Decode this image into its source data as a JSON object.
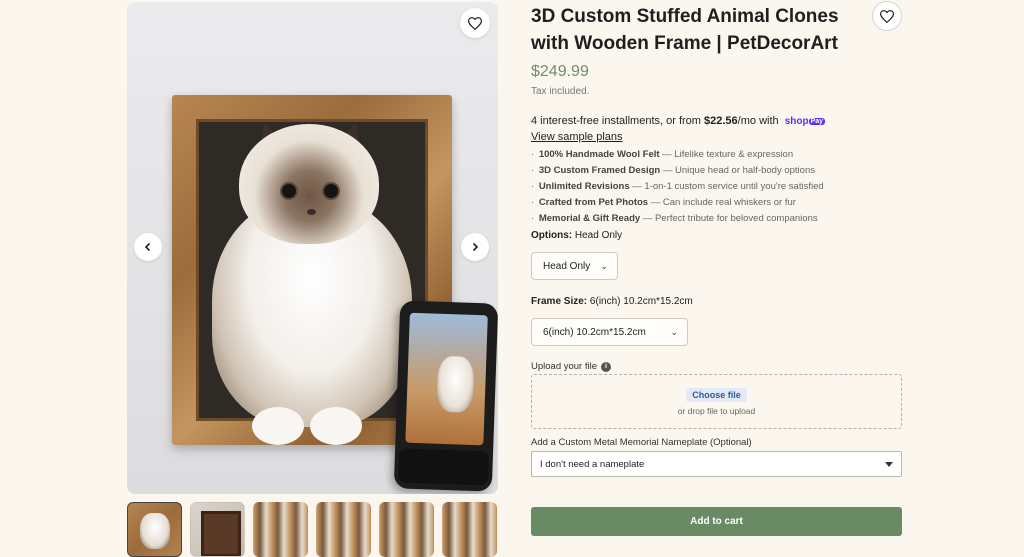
{
  "product": {
    "title": "3D Custom Stuffed Animal Clones with Wooden Frame | PetDecorArt",
    "price": "$249.99",
    "tax_note": "Tax included."
  },
  "installments": {
    "prefix": "4 interest-free installments, or from",
    "amount": "$22.56",
    "suffix": "/mo with",
    "brand": "shop",
    "brand_tag": "Pay",
    "brand_color": "#5a31f4",
    "sample_link": "View sample plans"
  },
  "features": [
    {
      "title": "100% Handmade Wool Felt",
      "desc": "— Lifelike texture & expression"
    },
    {
      "title": "3D Custom Framed Design",
      "desc": "— Unique head or half-body options"
    },
    {
      "title": "Unlimited Revisions",
      "desc": "— 1-on-1 custom service until you're satisfied"
    },
    {
      "title": "Crafted from Pet Photos",
      "desc": "— Can include real whiskers or fur"
    },
    {
      "title": "Memorial & Gift Ready",
      "desc": "— Perfect tribute for beloved companions"
    }
  ],
  "options": {
    "label": "Options:",
    "value": "Head Only",
    "selected": "Head Only"
  },
  "frame_size": {
    "label": "Frame Size:",
    "value": "6(inch) 10.2cm*15.2cm",
    "selected": "6(inch) 10.2cm*15.2cm"
  },
  "upload": {
    "label": "Upload your file",
    "button": "Choose file",
    "hint": "or drop file to upload"
  },
  "nameplate": {
    "label": "Add a Custom Metal Memorial Nameplate (Optional)",
    "selected": "I don't need a nameplate"
  },
  "cart": {
    "add_label": "Add to cart",
    "color": "#6a8a66"
  },
  "gallery": {
    "thumbnail_count": 6,
    "active_index": 0
  },
  "colors": {
    "price": "#6f8f6d",
    "background": "#fbf6ee"
  }
}
